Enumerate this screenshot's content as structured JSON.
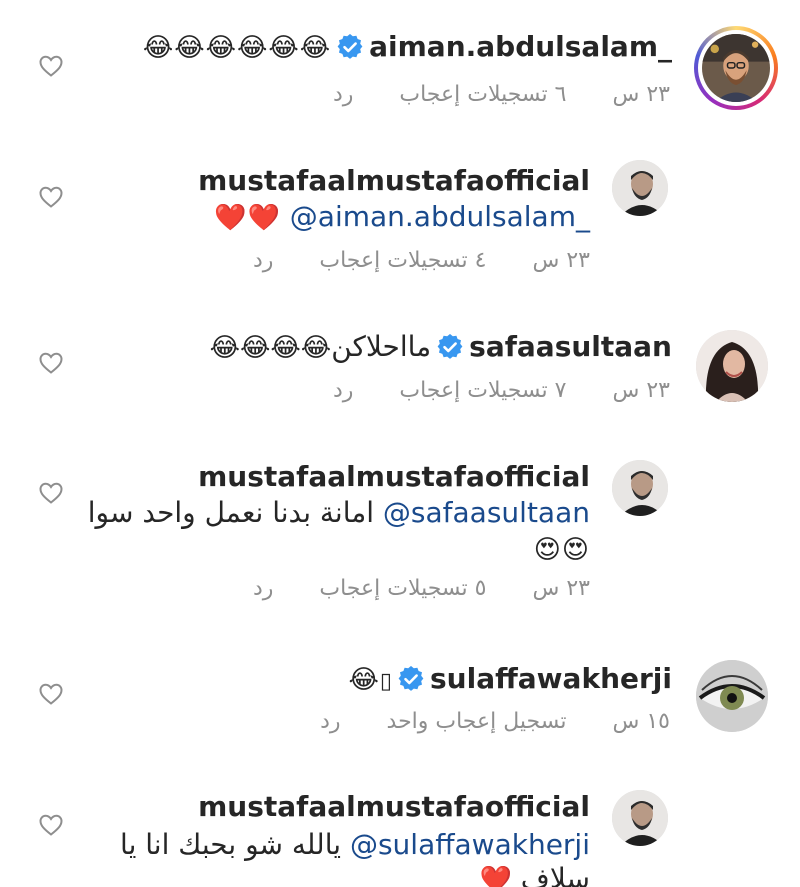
{
  "comments": [
    {
      "username": "_aiman.abdulsalam",
      "verified": true,
      "text": "",
      "mention": "",
      "emoji": "😂😂😂😂😂😂",
      "time": "٢٣ س",
      "likes": "٦ تسجيلات إعجاب",
      "reply": "رد"
    },
    {
      "username": "mustafaalmustafaofficial",
      "verified": false,
      "mention": "_aiman.abdulsalam@",
      "emoji": "❤️❤️",
      "time": "٢٣ س",
      "likes": "٤ تسجيلات إعجاب",
      "reply": "رد"
    },
    {
      "username": "safaasultaan",
      "verified": true,
      "text": "مااحلاكن",
      "emoji": "😂😂😂😂",
      "time": "٢٣ س",
      "likes": "٧ تسجيلات إعجاب",
      "reply": "رد"
    },
    {
      "username": "mustafaalmustafaofficial",
      "verified": false,
      "mention": "safaasultaan@",
      "text": "امانة بدنا نعمل واحد سوا",
      "emoji": "😍😍",
      "time": "٢٣ س",
      "likes": "٥ تسجيلات إعجاب",
      "reply": "رد"
    },
    {
      "username": "sulaffawakherji",
      "verified": true,
      "text": "",
      "emoji": "😂",
      "placeholder_glyph": "▯",
      "time": "١٥ س",
      "likes": "تسجيل إعجاب واحد",
      "reply": "رد"
    },
    {
      "username": "mustafaalmustafaofficial",
      "verified": false,
      "mention": "sulaffawakherji@",
      "text": "يالله شو بحبك انا يا",
      "text2": "سلاف",
      "emoji": "❤️"
    }
  ],
  "icons": {
    "like": "heart-outline-icon",
    "verified": "verified-badge-icon"
  },
  "colors": {
    "verified_blue": "#3897f0",
    "mention": "#1a4a8c",
    "meta_gray": "#8e8e8e",
    "heart_red": "#ed4956"
  }
}
